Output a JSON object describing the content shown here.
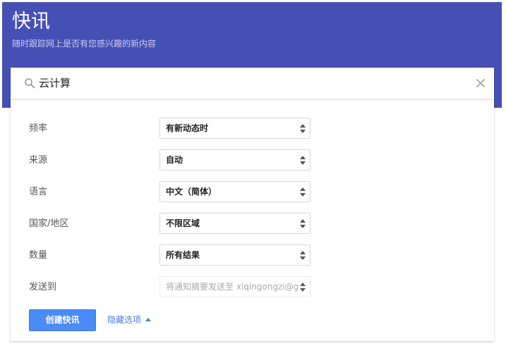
{
  "header": {
    "title": "快讯",
    "subtitle": "随时跟踪网上是否有您感兴趣的新内容"
  },
  "search": {
    "value": "云计算",
    "icon": "search-icon",
    "clear_icon": "close-icon"
  },
  "options": [
    {
      "label": "频率",
      "value": "有新动态时",
      "disabled": false
    },
    {
      "label": "来源",
      "value": "自动",
      "disabled": false
    },
    {
      "label": "语言",
      "value": "中文（简体）",
      "disabled": false
    },
    {
      "label": "国家/地区",
      "value": "不限区域",
      "disabled": false
    },
    {
      "label": "数量",
      "value": "所有结果",
      "disabled": false
    },
    {
      "label": "发送到",
      "value": "将通知摘要发送至 xiqingongzi@g",
      "disabled": true
    }
  ],
  "actions": {
    "create_label": "创建快讯",
    "hide_options_label": "隐藏选项"
  },
  "colors": {
    "header_bg": "#4650b4",
    "primary_button": "#4a8bf5",
    "link": "#4a7ed8"
  }
}
